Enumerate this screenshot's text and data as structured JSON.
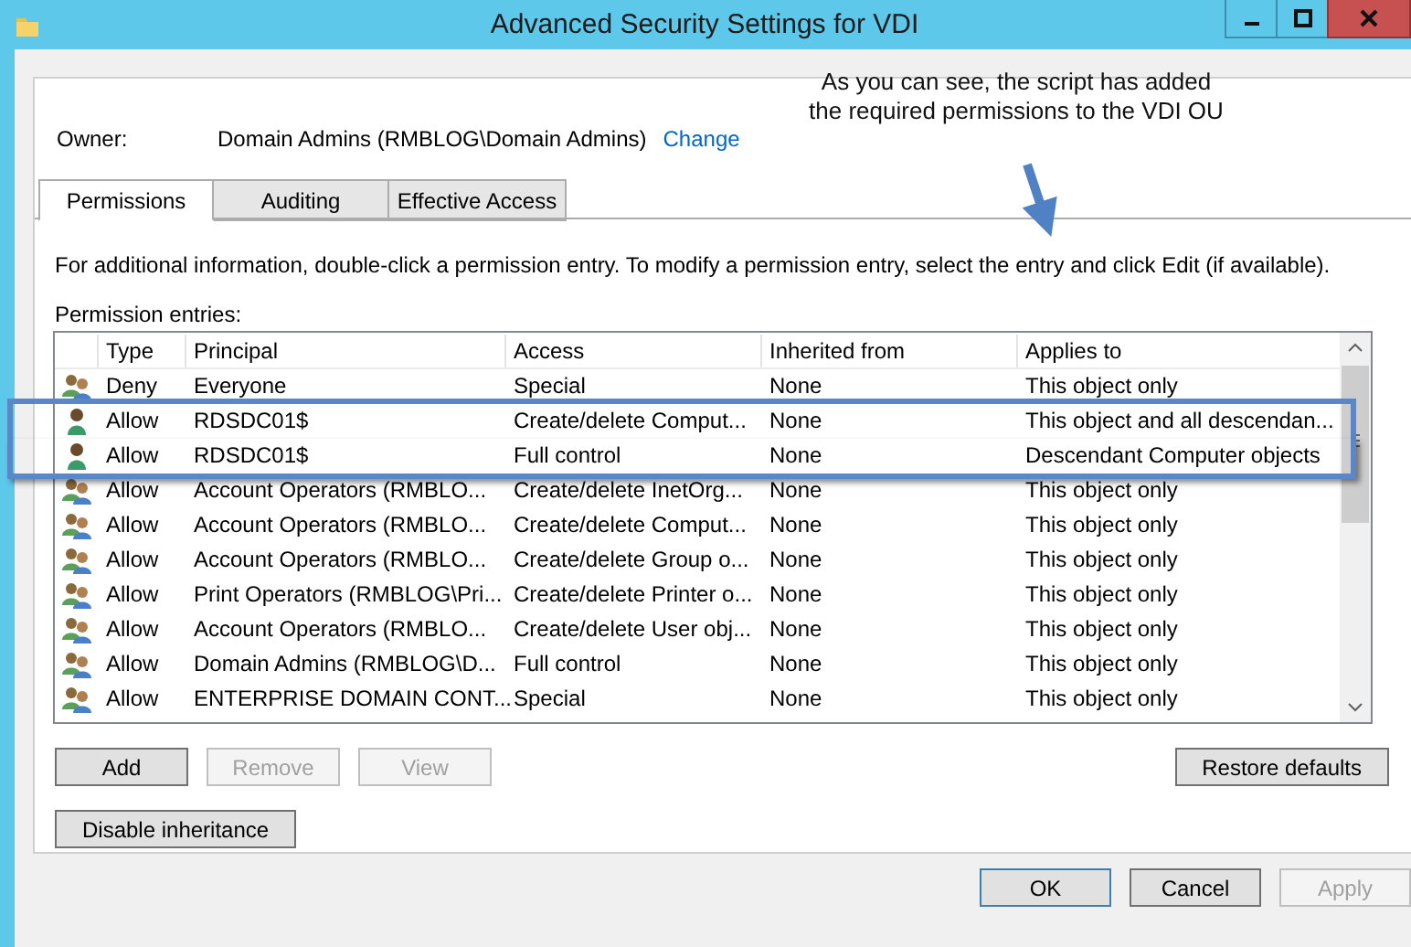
{
  "window": {
    "title": "Advanced Security Settings for VDI"
  },
  "owner": {
    "label": "Owner:",
    "value": "Domain Admins (RMBLOG\\Domain Admins)",
    "link": "Change"
  },
  "tabs": [
    {
      "label": "Permissions",
      "selected": true
    },
    {
      "label": "Auditing",
      "selected": false
    },
    {
      "label": "Effective Access",
      "selected": false
    }
  ],
  "info": "For additional information, double-click a permission entry. To modify a permission entry, select the entry and click Edit (if available).",
  "entries_label": "Permission entries:",
  "table": {
    "columns": [
      "Type",
      "Principal",
      "Access",
      "Inherited from",
      "Applies to"
    ],
    "rows": [
      {
        "kind": "group",
        "type": "Deny",
        "principal": "Everyone",
        "access": "Special",
        "inherited": "None",
        "applies": "This object only",
        "highlighted": false
      },
      {
        "kind": "user",
        "type": "Allow",
        "principal": "RDSDC01$",
        "access": "Create/delete Comput...",
        "inherited": "None",
        "applies": "This object and all descendan...",
        "highlighted": true
      },
      {
        "kind": "user",
        "type": "Allow",
        "principal": "RDSDC01$",
        "access": "Full control",
        "inherited": "None",
        "applies": "Descendant Computer objects",
        "highlighted": true
      },
      {
        "kind": "group",
        "type": "Allow",
        "principal": "Account Operators (RMBLO...",
        "access": "Create/delete InetOrg...",
        "inherited": "None",
        "applies": "This object only",
        "highlighted": false
      },
      {
        "kind": "group",
        "type": "Allow",
        "principal": "Account Operators (RMBLO...",
        "access": "Create/delete Comput...",
        "inherited": "None",
        "applies": "This object only",
        "highlighted": false
      },
      {
        "kind": "group",
        "type": "Allow",
        "principal": "Account Operators (RMBLO...",
        "access": "Create/delete Group o...",
        "inherited": "None",
        "applies": "This object only",
        "highlighted": false
      },
      {
        "kind": "group",
        "type": "Allow",
        "principal": "Print Operators (RMBLOG\\Pri...",
        "access": "Create/delete Printer o...",
        "inherited": "None",
        "applies": "This object only",
        "highlighted": false
      },
      {
        "kind": "group",
        "type": "Allow",
        "principal": "Account Operators (RMBLO...",
        "access": "Create/delete User obj...",
        "inherited": "None",
        "applies": "This object only",
        "highlighted": false
      },
      {
        "kind": "group",
        "type": "Allow",
        "principal": "Domain Admins (RMBLOG\\D...",
        "access": "Full control",
        "inherited": "None",
        "applies": "This object only",
        "highlighted": false
      },
      {
        "kind": "group",
        "type": "Allow",
        "principal": "ENTERPRISE DOMAIN CONT...",
        "access": "Special",
        "inherited": "None",
        "applies": "This object only",
        "highlighted": false
      }
    ]
  },
  "entry_buttons": [
    {
      "label": "Add",
      "disabled": false
    },
    {
      "label": "Remove",
      "disabled": true
    },
    {
      "label": "View",
      "disabled": true
    }
  ],
  "restore_button": {
    "label": "Restore defaults",
    "disabled": false
  },
  "inheritance_button": {
    "label": "Disable inheritance",
    "disabled": false
  },
  "dialog_buttons": [
    {
      "label": "OK",
      "disabled": false,
      "default": true
    },
    {
      "label": "Cancel",
      "disabled": false,
      "default": false
    },
    {
      "label": "Apply",
      "disabled": true,
      "default": false
    }
  ],
  "annotation": {
    "text": "As you can see, the script has added the required permissions to the VDI OU"
  }
}
